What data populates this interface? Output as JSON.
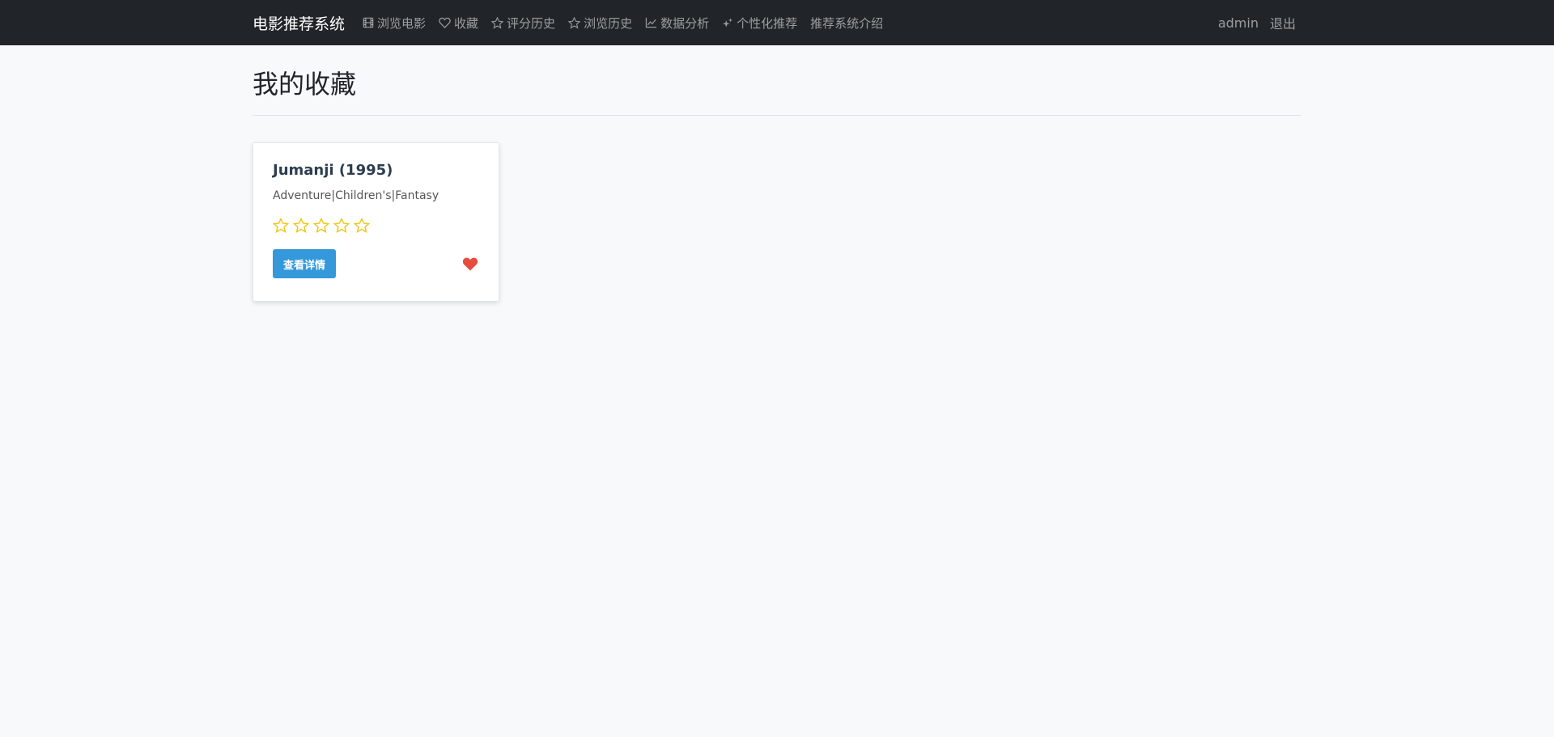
{
  "navbar": {
    "brand": "电影推荐系统",
    "links": [
      {
        "label": "浏览电影",
        "icon": "film-icon"
      },
      {
        "label": "收藏",
        "icon": "heart-outline-icon"
      },
      {
        "label": "评分历史",
        "icon": "star-outline-icon"
      },
      {
        "label": "浏览历史",
        "icon": "star-outline-icon"
      },
      {
        "label": "数据分析",
        "icon": "line-chart-icon"
      },
      {
        "label": "个性化推荐",
        "icon": "sparkles-icon"
      },
      {
        "label": "推荐系统介绍",
        "icon": ""
      }
    ],
    "user": "admin",
    "logout": "退出"
  },
  "page": {
    "title": "我的收藏"
  },
  "favorites": [
    {
      "title": "Jumanji (1995)",
      "genres": "Adventure|Children's|Fantasy",
      "rating": 0,
      "max_rating": 5,
      "detail_button": "查看详情",
      "favorited": true
    }
  ],
  "colors": {
    "navbar_bg": "#212529",
    "star": "#f1c40f",
    "button": "#3498db",
    "heart": "#e74c3c"
  }
}
